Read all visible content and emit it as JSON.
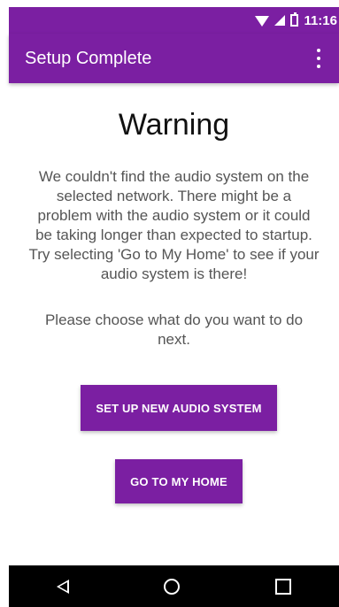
{
  "status": {
    "time": "11:16"
  },
  "appbar": {
    "title": "Setup Complete"
  },
  "content": {
    "heading": "Warning",
    "message": "We couldn't find the audio system on the selected network. There might be a problem with the audio system or it could be taking longer than expected to startup. Try selecting 'Go to My Home' to see if your audio system is there!",
    "prompt": "Please choose what do you want to do next."
  },
  "buttons": {
    "setup_new": "SET UP NEW AUDIO SYSTEM",
    "go_home": "GO TO MY HOME"
  },
  "icons": {
    "wifi": "wifi-icon",
    "signal": "signal-icon",
    "battery": "battery-icon",
    "overflow": "overflow-menu-icon",
    "back": "back-icon",
    "home": "home-icon",
    "recents": "recents-icon"
  },
  "colors": {
    "primary": "#7B1FA2",
    "text": "#555555",
    "navbar": "#000000"
  }
}
